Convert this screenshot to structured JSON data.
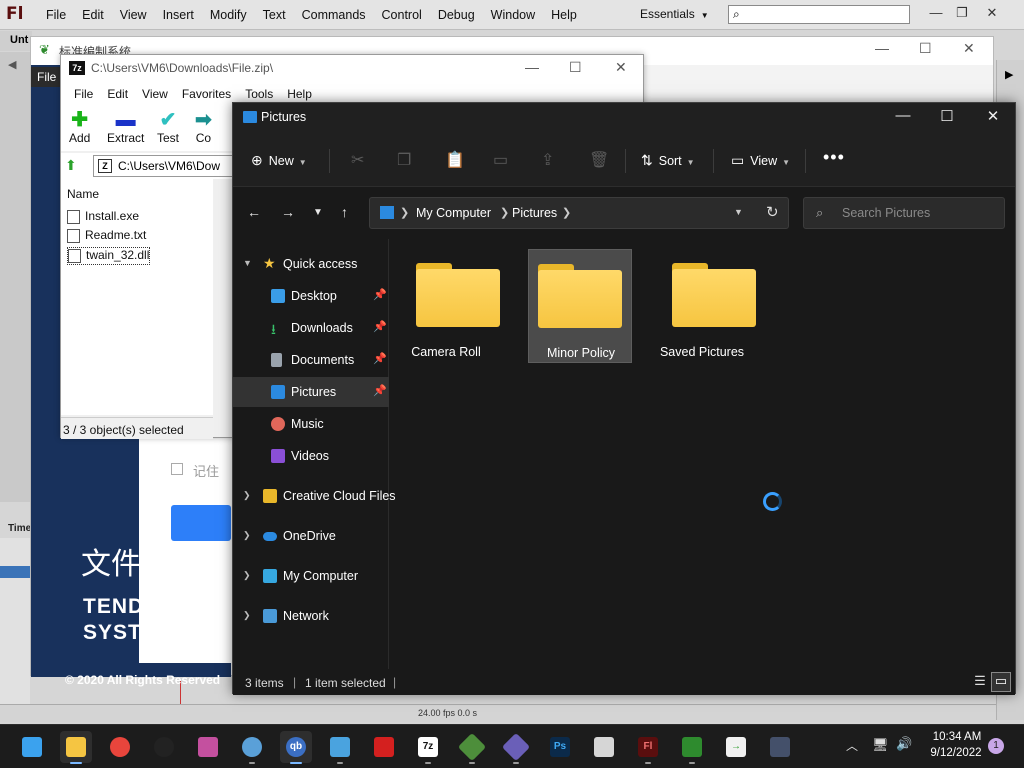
{
  "flash": {
    "logo": "Fl",
    "menu": [
      "File",
      "Edit",
      "View",
      "Insert",
      "Modify",
      "Text",
      "Commands",
      "Control",
      "Debug",
      "Window",
      "Help"
    ],
    "workspace": "Essentials",
    "doc_tab": "Unt",
    "timeline_label": "Time",
    "fps": "24.00 fps   0.0 s"
  },
  "login": {
    "title": "标准编制系统",
    "file_strip": "File",
    "remember": "记住",
    "big_text": "文件",
    "en_line1": "TEND",
    "en_line2": "SYST",
    "copyright": "© 2020 All Rights Reserved"
  },
  "zip": {
    "title": "C:\\Users\\VM6\\Downloads\\File.zip\\",
    "menu": [
      "File",
      "Edit",
      "View",
      "Favorites",
      "Tools",
      "Help"
    ],
    "tools": {
      "add": "Add",
      "extract": "Extract",
      "test": "Test",
      "copy": "Co"
    },
    "path": "C:\\Users\\VM6\\Dow",
    "column_name": "Name",
    "files": [
      "Install.exe",
      "Readme.txt",
      "twain_32.dll"
    ],
    "status": "3 / 3 object(s) selected"
  },
  "explorer": {
    "title": "Pictures",
    "commands": {
      "new": "New",
      "sort": "Sort",
      "view": "View",
      "more": "•••"
    },
    "address": {
      "crumb1": "My Computer",
      "crumb2": "Pictures"
    },
    "search_placeholder": "Search Pictures",
    "nav": {
      "quick_access": "Quick access",
      "desktop": "Desktop",
      "downloads": "Downloads",
      "documents": "Documents",
      "pictures": "Pictures",
      "music": "Music",
      "videos": "Videos",
      "creative_cloud": "Creative Cloud Files",
      "onedrive": "OneDrive",
      "my_computer": "My Computer",
      "network": "Network"
    },
    "folders": [
      "Camera Roll",
      "Minor Policy",
      "Saved Pictures"
    ],
    "status": {
      "items": "3 items",
      "selected": "1 item selected"
    }
  },
  "taskbar": {
    "time": "10:34 AM",
    "date": "9/12/2022",
    "notifications": "1",
    "app_labels": {
      "7zip": "7z",
      "flash": "Fl",
      "photoshop": "Ps"
    }
  },
  "colors": {
    "explorer_bg": "#191919",
    "folder_yellow": "#f6c540",
    "accent": "#3aa0ff"
  }
}
